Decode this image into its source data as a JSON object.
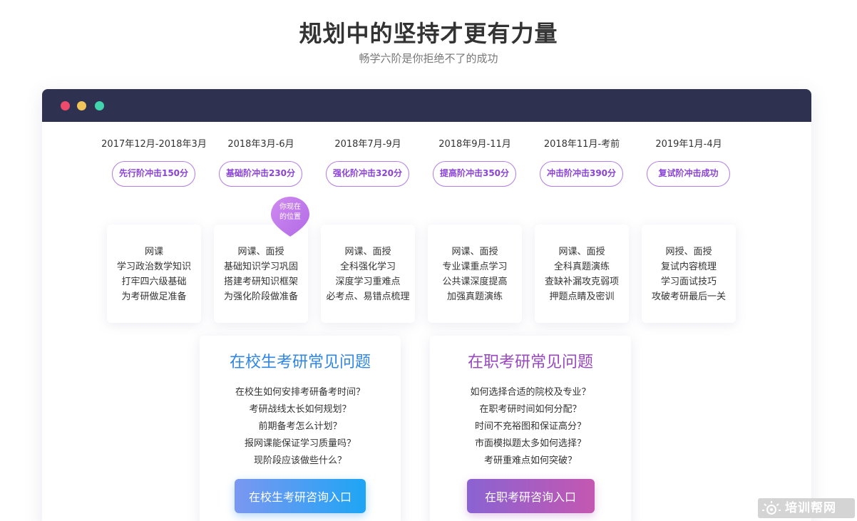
{
  "header": {
    "title": "规划中的坚持才更有力量",
    "subtitle": "畅学六阶是你拒绝不了的成功"
  },
  "window": {
    "dots": [
      "#ee4a6b",
      "#f1c45a",
      "#41d4ad"
    ]
  },
  "stages": [
    {
      "date": "2017年12月-2018年3月",
      "pill": "先行阶冲击150分",
      "lines": [
        "网课",
        "学习政治数学知识",
        "打牢四六级基础",
        "为考研做足准备"
      ]
    },
    {
      "date": "2018年3月-6月",
      "pill": "基础阶冲击230分",
      "lines": [
        "网课、面授",
        "基础知识学习巩固",
        "搭建考研知识框架",
        "为强化阶段做准备"
      ]
    },
    {
      "date": "2018年7月-9月",
      "pill": "强化阶冲击320分",
      "lines": [
        "网课、面授",
        "全科强化学习",
        "深度学习重难点",
        "必考点、易错点梳理"
      ]
    },
    {
      "date": "2018年9月-11月",
      "pill": "提高阶冲击350分",
      "lines": [
        "网课、面授",
        "专业课重点学习",
        "公共课深度提高",
        "加强真题演练"
      ]
    },
    {
      "date": "2018年11月-考前",
      "pill": "冲击阶冲击390分",
      "lines": [
        "网课、面授",
        "全科真题演练",
        "查缺补漏攻克弱项",
        "押题点睛及密训"
      ]
    },
    {
      "date": "2019年1月-4月",
      "pill": "复试阶冲击成功",
      "lines": [
        "网授、面授",
        "复试内容梳理",
        "学习面试技巧",
        "攻破考研最后一关"
      ]
    }
  ],
  "marker": {
    "line1": "你现在",
    "line2": "的位置"
  },
  "faq_campus": {
    "title": "在校生考研常见问题",
    "questions": [
      "在校生如何安排考研备考时间？",
      "考研战线太长如何规划？",
      "前期备考怎么计划？",
      "报网课能保证学习质量吗？",
      "现阶段应该做些什么？"
    ],
    "button": "在校生考研咨询入口"
  },
  "faq_work": {
    "title": "在职考研常见问题",
    "questions": [
      "如何选择合适的院校及专业？",
      "在职考研时间如何分配？",
      "时间不充裕图和保证高分？",
      "市面模拟题太多如何选择？",
      "考研重难点如何突破？"
    ],
    "button": "在职考研咨询入口"
  },
  "watermark": {
    "text": "培训帮网"
  },
  "colors": {
    "accent_purple": "#8a43d6",
    "window_bar": "#2e3250",
    "campus_blue": "#2f86e6",
    "work_purple": "#9a48c2"
  }
}
